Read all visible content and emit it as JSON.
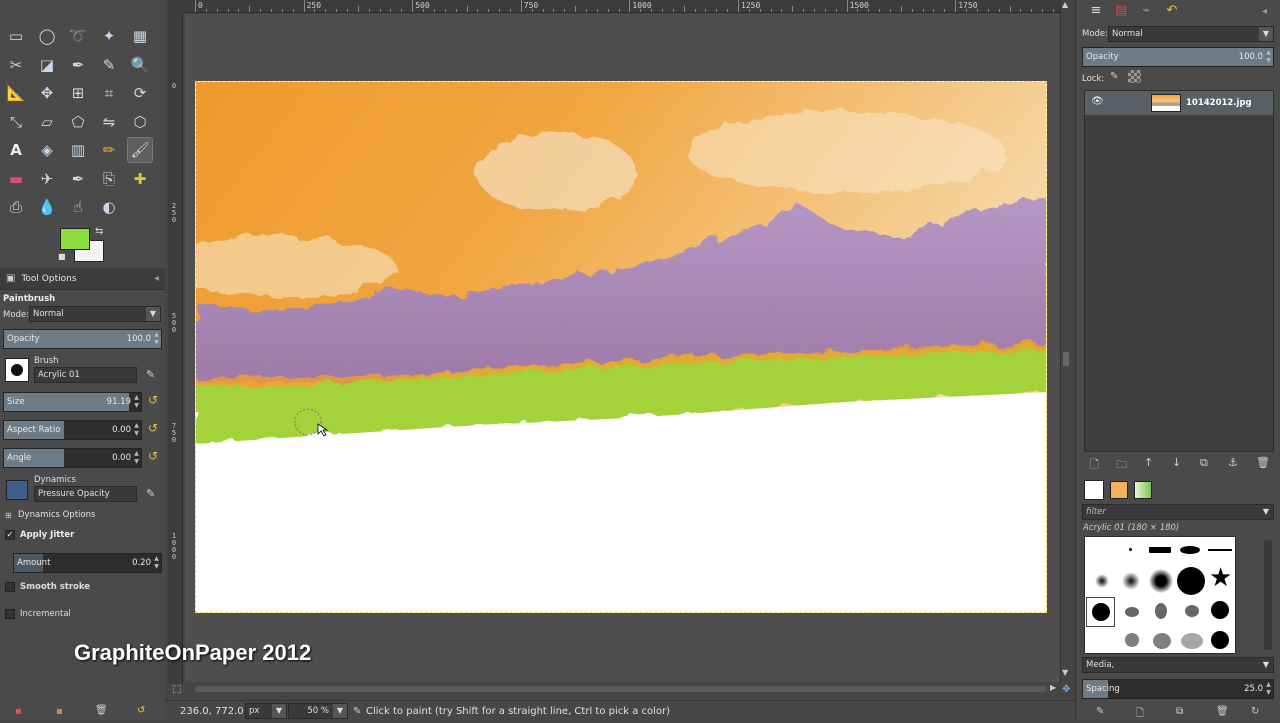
{
  "toolbox": {
    "tools": [
      "rect-select",
      "ellipse-select",
      "free-select",
      "fuzzy-select",
      "by-color-select",
      "scissors-select",
      "foreground-select",
      "paths",
      "color-picker",
      "zoom",
      "measure",
      "move",
      "align",
      "crop",
      "rotate",
      "scale",
      "shear",
      "perspective",
      "flip",
      "cage",
      "text",
      "bucket-fill",
      "blend",
      "pencil",
      "paintbrush",
      "eraser",
      "airbrush",
      "ink",
      "clone",
      "heal",
      "perspective-clone",
      "blur",
      "smudge",
      "dodge-burn"
    ],
    "fg_color": "#8cdc40",
    "bg_color": "#f3f3f3"
  },
  "tool_options": {
    "tab_label": "Tool Options",
    "tool_name": "Paintbrush",
    "mode_label": "Mode:",
    "mode_value": "Normal",
    "opacity_label": "Opacity",
    "opacity_value": "100.0",
    "opacity_fraction": 1.0,
    "brush_label": "Brush",
    "brush_value": "Acrylic 01",
    "size_label": "Size",
    "size_value": "91.19",
    "size_fraction": 0.91,
    "aspect_label": "Aspect Ratio",
    "aspect_value": "0.00",
    "angle_label": "Angle",
    "angle_value": "0.00",
    "dynamics_label": "Dynamics",
    "dynamics_value": "Pressure Opacity",
    "dynamics_options_label": "Dynamics Options",
    "apply_jitter_label": "Apply Jitter",
    "amount_label": "Amount",
    "amount_value": "0.20",
    "smooth_stroke_label": "Smooth stroke",
    "incremental_label": "Incremental"
  },
  "ruler": {
    "top_labels": [
      "0",
      "250",
      "500",
      "750",
      "1000",
      "1250",
      "1500",
      "1750"
    ]
  },
  "status": {
    "coords": "236.0, 772.0",
    "unit": "px",
    "zoom": "50 %",
    "message": "Click to paint (try Shift for a straight line, Ctrl to pick a color)"
  },
  "watermark": "GraphiteOnPaper 2012",
  "layers": {
    "mode_label": "Mode:",
    "mode_value": "Normal",
    "opacity_label": "Opacity",
    "opacity_value": "100.0",
    "lock_label": "Lock:",
    "layer_name": "10142012.jpg"
  },
  "brushes": {
    "filter_placeholder": "filter",
    "brush_title": "Acrylic 01 (180 × 180)",
    "tag_value": "Media,",
    "spacing_label": "Spacing",
    "spacing_value": "25.0"
  }
}
